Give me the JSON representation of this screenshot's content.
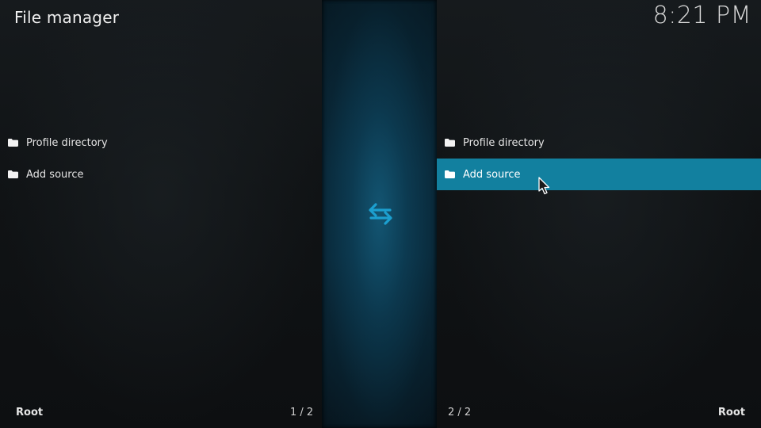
{
  "header": {
    "title": "File manager",
    "clock": "8:21 PM"
  },
  "left_pane": {
    "items": [
      {
        "label": "Profile directory",
        "icon": "folder-icon"
      },
      {
        "label": "Add source",
        "icon": "folder-icon"
      }
    ],
    "footer_path": "Root",
    "footer_count": "1 / 2"
  },
  "right_pane": {
    "items": [
      {
        "label": "Profile directory",
        "icon": "folder-icon"
      },
      {
        "label": "Add source",
        "icon": "folder-icon",
        "selected": true
      }
    ],
    "footer_path": "Root",
    "footer_count": "2 / 2"
  },
  "center": {
    "icon": "swap-arrows-icon"
  },
  "colors": {
    "accent": "#12809f",
    "swap_icon": "#1c9fcf",
    "center_strip": "#0c3a52"
  }
}
